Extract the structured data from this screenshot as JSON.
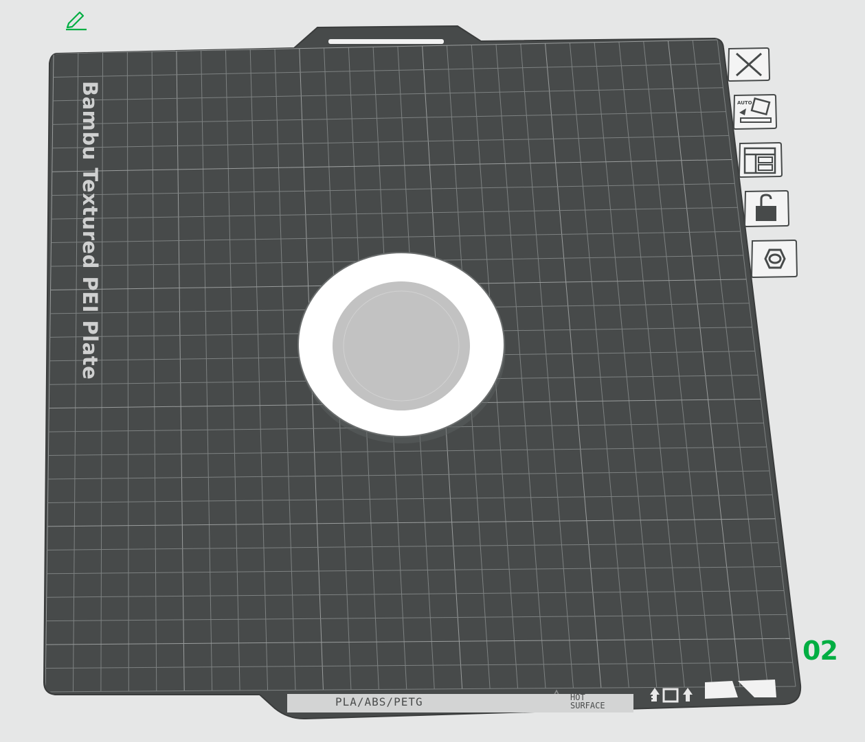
{
  "plate": {
    "name": "Bambu Textured PEI Plate",
    "number": "02",
    "material_label": "PLA/ABS/PETG",
    "warning_line1": "HOT",
    "warning_line2": "SURFACE"
  },
  "toolbar": {
    "buttons": [
      {
        "name": "close-icon",
        "label": "Close"
      },
      {
        "name": "auto-orient-icon",
        "label": "AUTO"
      },
      {
        "name": "arrange-icon",
        "label": "Arrange"
      },
      {
        "name": "lock-icon",
        "label": "Lock"
      },
      {
        "name": "plate-settings-icon",
        "label": "Settings"
      }
    ]
  },
  "colors": {
    "background": "#e6e7e7",
    "plate": "#474a4a",
    "grid": "#8a8d8d",
    "accent": "#00ae42",
    "object_ring": "#ffffff",
    "object_center": "#c2c2c2"
  }
}
